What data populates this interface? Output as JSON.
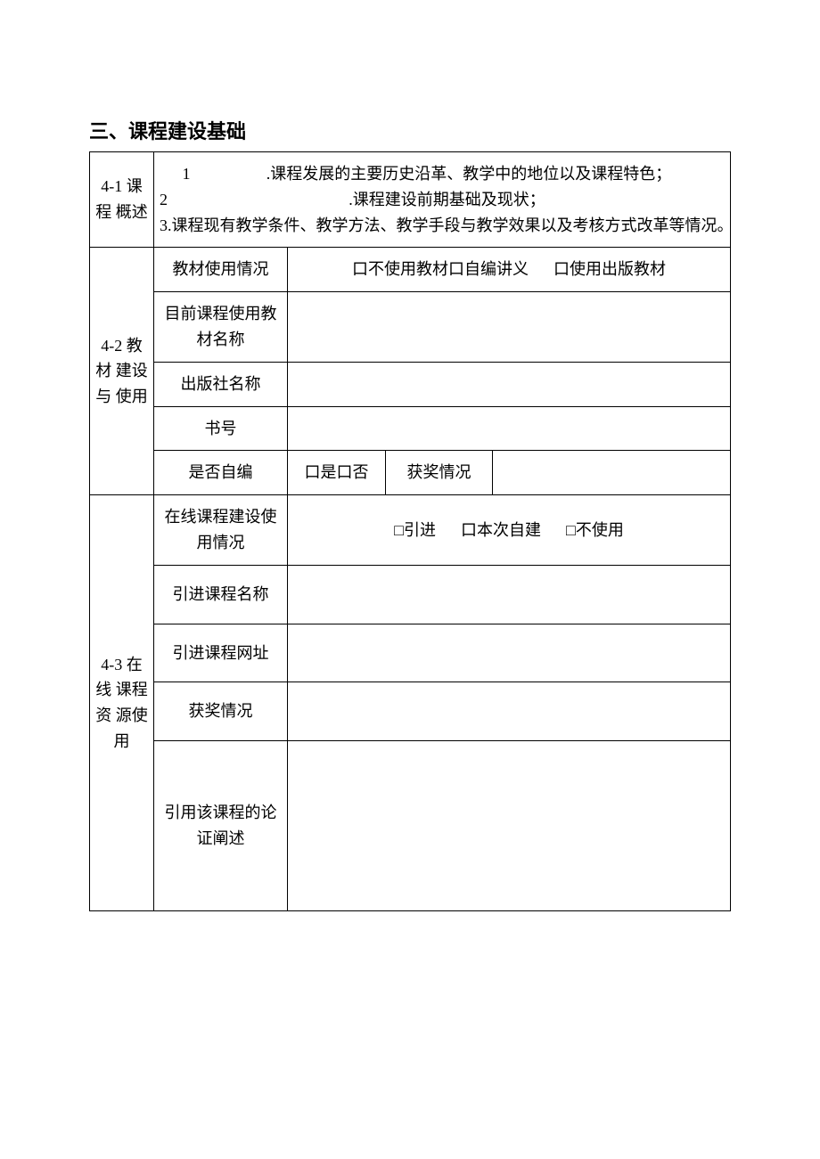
{
  "section_title": "三、课程建设基础",
  "row41": {
    "header": "4-1 课程 概述",
    "items": [
      {
        "num": "1",
        "text": ".课程发展的主要历史沿革、教学中的地位以及课程特色；",
        "wide": true
      },
      {
        "num": "2",
        "text": ".课程建设前期基础及现状；",
        "wide": false
      },
      {
        "num": "3",
        "text": ".课程现有教学条件、教学方法、教学手段与教学效果以及考核方式改革等情况。",
        "wide": true
      }
    ]
  },
  "row42": {
    "header": "4-2 教材 建设与 使用",
    "r1_label": "教材使用情况",
    "r1_opts": [
      "口不使用教材口自编讲义",
      "口使用出版教材"
    ],
    "r2_label": "目前课程使用教 材名称",
    "r3_label": "出版社名称",
    "r4_label": "书号",
    "r5_label": "是否自编",
    "r5_val": "口是口否",
    "r5_award_label": "获奖情况",
    "r5_award_val": ""
  },
  "row43": {
    "header": "4-3 在线 课程资 源使用",
    "r1_label": "在线课程建设使 用情况",
    "r1_opts": [
      "□引进",
      "口本次自建",
      "□不使用"
    ],
    "r2_label": "引进课程名称",
    "r3_label": "引进课程网址",
    "r4_label": "获奖情况",
    "r5_label": "引用该课程的论 证阐述"
  }
}
